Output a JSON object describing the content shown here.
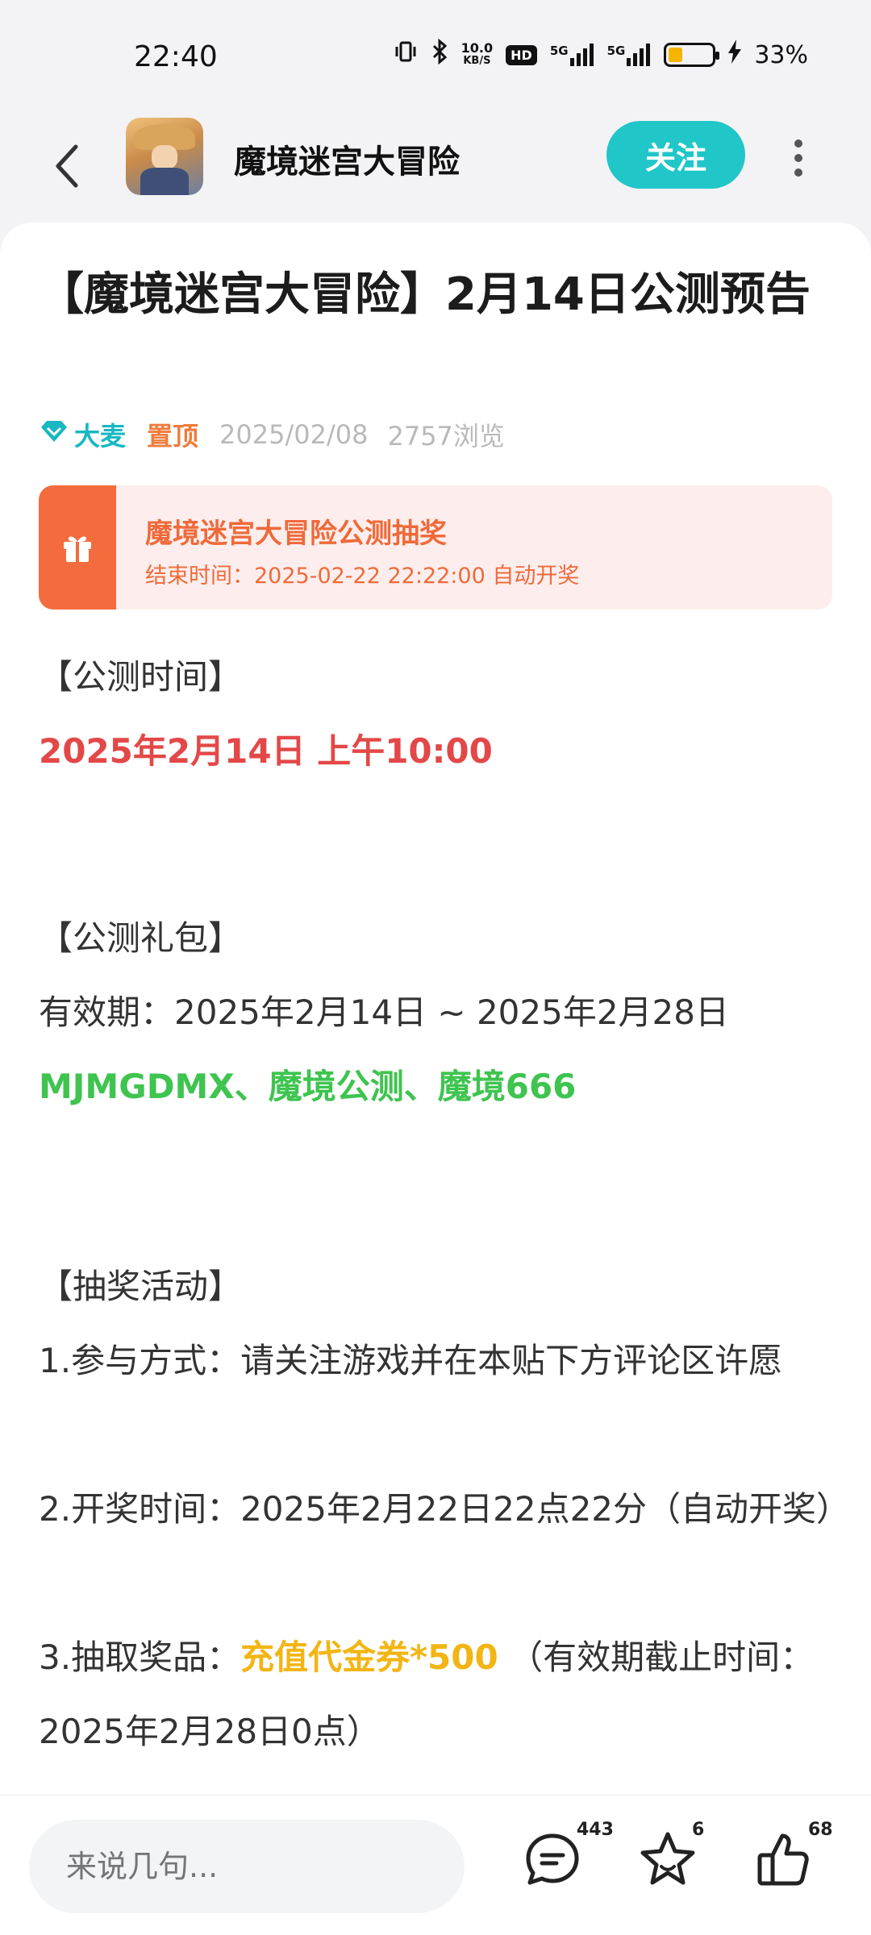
{
  "status_bar": {
    "time": "22:40",
    "speed_value": "10.0",
    "speed_unit": "KB/S",
    "hd_label": "HD",
    "signal1": "5G",
    "signal2": "5G",
    "battery_percent": "33%",
    "battery_level": 0.33
  },
  "nav": {
    "title": "魔境迷宫大冒险",
    "follow_label": "关注"
  },
  "post": {
    "title": "【魔境迷宫大冒险】2月14日公测预告",
    "author": "大麦",
    "pinned": "置顶",
    "date": "2025/02/08",
    "views": "2757浏览"
  },
  "lottery": {
    "title": "魔境迷宫大冒险公测抽奖",
    "subtitle": "结束时间：2025-02-22 22:22:00 自动开奖"
  },
  "content": {
    "h1": "【公测时间】",
    "launch_time": "2025年2月14日 上午10:00",
    "h2": "【公测礼包】",
    "validity": "有效期：2025年2月14日 ~ 2025年2月28日",
    "codes": "MJMGDMX、魔境公测、魔境666",
    "h3": "【抽奖活动】",
    "item1": "1.参与方式：请关注游戏并在本贴下方评论区许愿",
    "item2": "2.开奖时间：2025年2月22日22点22分（自动开奖）",
    "item3_prefix": "3.抽取奖品：",
    "item3_prize": "充值代金券*500",
    "item3_suffix": "（有效期截止时间：2025年2月28日0点）"
  },
  "bottom": {
    "comment_placeholder": "来说几句...",
    "comment_count": "443",
    "favorite_count": "6",
    "like_count": "68"
  }
}
